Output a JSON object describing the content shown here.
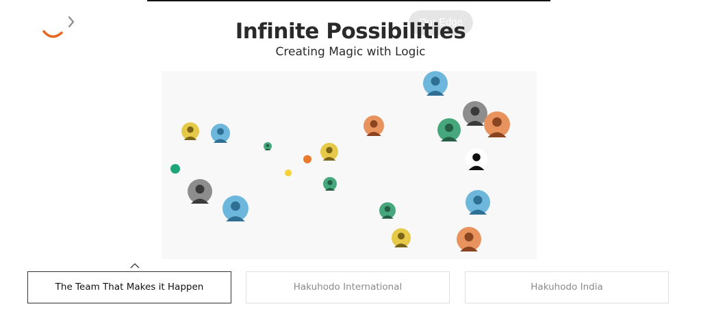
{
  "header": {
    "nav_pill_label": "Our Edge"
  },
  "hero": {
    "title": "Infinite Possibilities",
    "subtitle": "Creating Magic with Logic"
  },
  "tabs": [
    {
      "label": "The Team That Makes it Happen",
      "active": true
    },
    {
      "label": "Hakuhodo International",
      "active": false
    },
    {
      "label": "Hakuhodo India",
      "active": false
    }
  ],
  "colors": {
    "accent_orange": "#e8661f",
    "tone_yellow": "#e7c94a",
    "tone_blue": "#6db6dc",
    "tone_green": "#46a77d",
    "tone_orange": "#e8935e",
    "tone_gray": "#8d8d8d",
    "dot_green": "#1fa57a",
    "dot_orange": "#ea7a2e",
    "dot_yellow": "#f4d23a"
  },
  "team_avatars": [
    {
      "name": "team-member-avatar",
      "tone": "blue"
    },
    {
      "name": "team-member-avatar",
      "tone": "gray"
    },
    {
      "name": "team-member-avatar",
      "tone": "orange"
    },
    {
      "name": "team-member-avatar",
      "tone": "orange"
    },
    {
      "name": "team-member-avatar",
      "tone": "green"
    },
    {
      "name": "team-member-avatar",
      "tone": "yellow"
    },
    {
      "name": "team-member-avatar",
      "tone": "blue"
    },
    {
      "name": "team-member-avatar",
      "tone": "green"
    },
    {
      "name": "team-member-avatar",
      "tone": "yellow"
    },
    {
      "name": "team-member-avatar",
      "tone": "black"
    },
    {
      "name": "team-member-avatar",
      "tone": "green"
    },
    {
      "name": "team-member-avatar",
      "tone": "gray"
    },
    {
      "name": "team-member-avatar",
      "tone": "blue"
    },
    {
      "name": "team-member-avatar",
      "tone": "blue"
    },
    {
      "name": "team-member-avatar",
      "tone": "green"
    },
    {
      "name": "team-member-avatar",
      "tone": "yellow"
    },
    {
      "name": "team-member-avatar",
      "tone": "orange"
    }
  ]
}
